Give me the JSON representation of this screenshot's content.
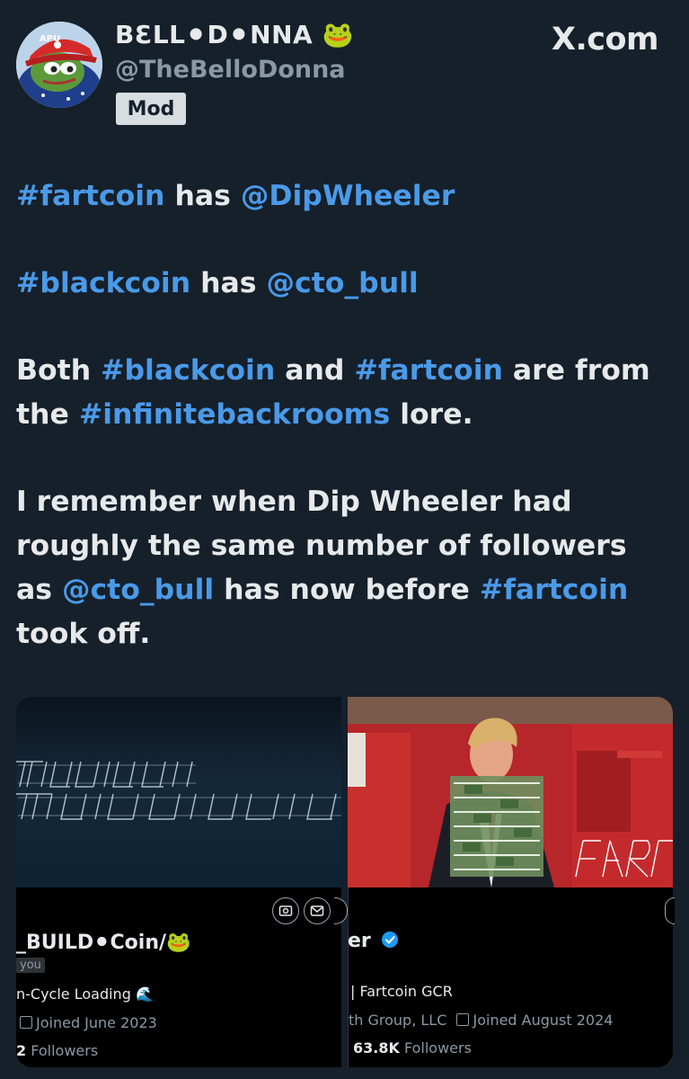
{
  "author": {
    "display_name": "BƐLL⚫D⚫NNA 🐸",
    "handle": "@TheBelloDonna",
    "badge": "Mod"
  },
  "brand": "X.com",
  "tweet": {
    "p1": {
      "tag": "#fartcoin",
      "mid": " has ",
      "mention": "@DipWheeler"
    },
    "p2": {
      "tag": "#blackcoin",
      "mid": " has ",
      "mention": "@cto_bull"
    },
    "p3": {
      "a": "Both ",
      "tag1": "#blackcoin",
      "b": " and ",
      "tag2": "#fartcoin",
      "c": " are from the ",
      "tag3": "#infinitebackrooms",
      "d": " lore."
    },
    "p4": {
      "a": "I remember when Dip Wheeler had roughly the same number of followers as ",
      "mention": "@cto_bull",
      "b": " has now before ",
      "tag": "#fartcoin",
      "c": " took off."
    }
  },
  "cards": {
    "left": {
      "name": "_BUILD⚫Coin/🐸",
      "follows_you": "you",
      "bio": "n-Cycle Loading 🌊",
      "joined": "Joined June 2023",
      "followers_count": "2",
      "followers_label": " Followers"
    },
    "right": {
      "name": "er",
      "bio": "| Fartcoin GCR",
      "company": "th Group, LLC",
      "joined": "Joined August 2024",
      "followers_count": "63.8K",
      "followers_label": " Followers"
    }
  },
  "colors": {
    "background": "#15202b",
    "link": "#4a9ae8",
    "verified": "#1d9bf0"
  }
}
